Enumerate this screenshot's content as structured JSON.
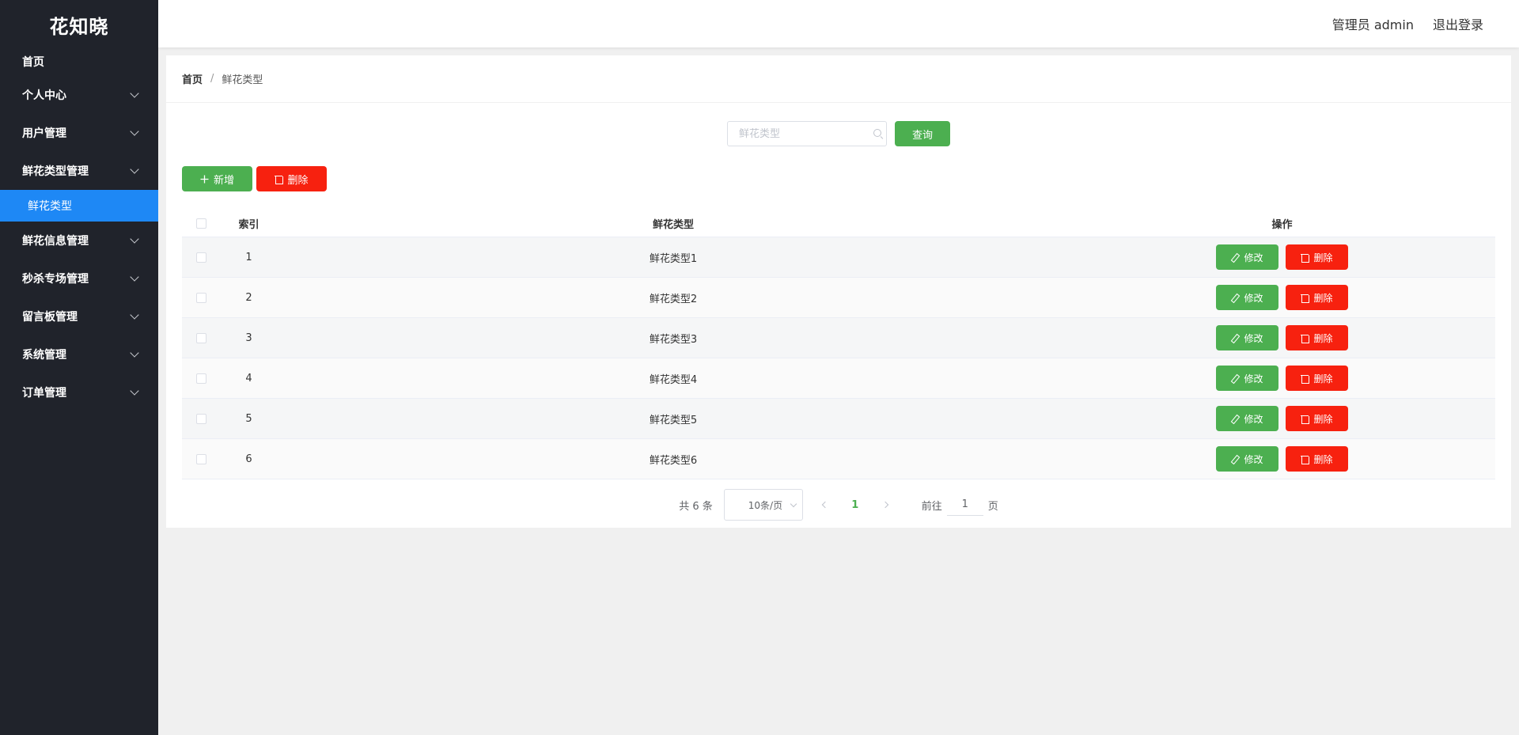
{
  "app": {
    "logo": "花知晓"
  },
  "sidebar": {
    "items": [
      {
        "label": "首页",
        "has_children": false
      },
      {
        "label": "个人中心",
        "has_children": true
      },
      {
        "label": "用户管理",
        "has_children": true
      },
      {
        "label": "鲜花类型管理",
        "has_children": true,
        "expanded": true,
        "children": [
          {
            "label": "鲜花类型",
            "active": true
          }
        ]
      },
      {
        "label": "鲜花信息管理",
        "has_children": true
      },
      {
        "label": "秒杀专场管理",
        "has_children": true
      },
      {
        "label": "留言板管理",
        "has_children": true
      },
      {
        "label": "系统管理",
        "has_children": true
      },
      {
        "label": "订单管理",
        "has_children": true
      }
    ],
    "active_color": "#1e88f5",
    "bg_color": "#20232b"
  },
  "header": {
    "user": "管理员 admin",
    "logout": "退出登录"
  },
  "breadcrumb": {
    "home": "首页",
    "separator": "/",
    "current": "鲜花类型"
  },
  "search": {
    "placeholder": "鲜花类型",
    "value": "",
    "button": "查询"
  },
  "actions": {
    "add": "新增",
    "delete": "删除"
  },
  "table": {
    "columns": [
      "索引",
      "鲜花类型",
      "操作"
    ],
    "rows": [
      {
        "index": "1",
        "type": "鲜花类型1"
      },
      {
        "index": "2",
        "type": "鲜花类型2"
      },
      {
        "index": "3",
        "type": "鲜花类型3"
      },
      {
        "index": "4",
        "type": "鲜花类型4"
      },
      {
        "index": "5",
        "type": "鲜花类型5"
      },
      {
        "index": "6",
        "type": "鲜花类型6"
      }
    ],
    "edit_label": "修改",
    "delete_label": "删除"
  },
  "pagination": {
    "total": "共 6 条",
    "page_size": "10条/页",
    "current_page": "1",
    "goto_prefix": "前往",
    "goto_value": "1",
    "goto_suffix": "页"
  },
  "colors": {
    "green": "#4caf50",
    "red": "#f7210f"
  }
}
